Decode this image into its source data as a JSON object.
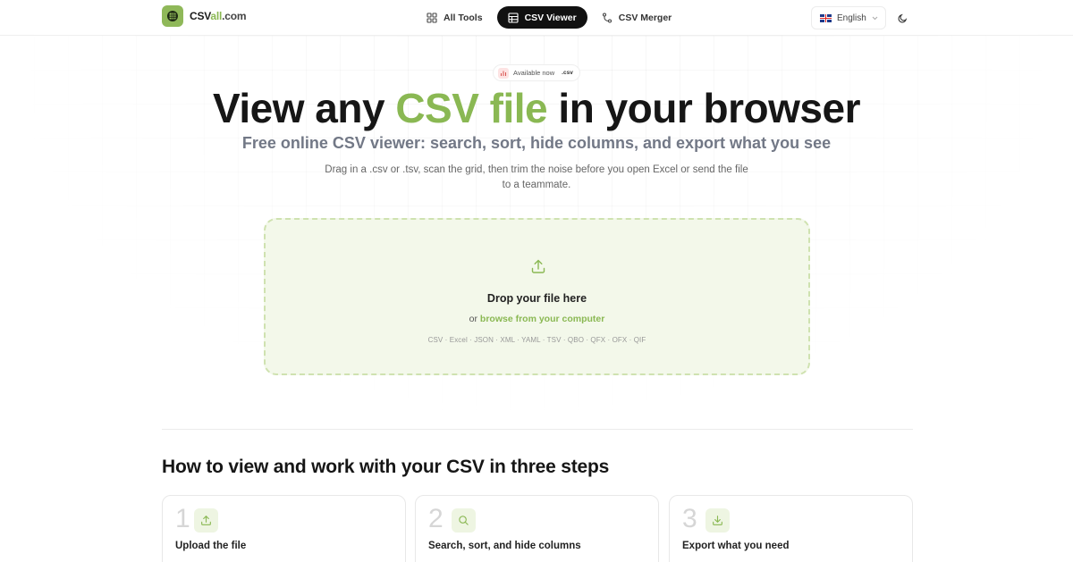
{
  "header": {
    "logo": {
      "prefix": "CSV",
      "accent": "all",
      "suffix": ".com"
    },
    "nav": [
      {
        "label": "All Tools",
        "icon": "grid-icon"
      },
      {
        "label": "CSV Viewer",
        "icon": "table-icon",
        "active": true
      },
      {
        "label": "CSV Merger",
        "icon": "merge-icon"
      }
    ],
    "language": {
      "label": "English",
      "flag": "uk-flag-icon"
    },
    "theme_toggle_icon": "moon-icon"
  },
  "hero": {
    "badge": {
      "text": "Available now",
      "ext": ".csv"
    },
    "title": {
      "part1": "View any ",
      "accent": "CSV file",
      "part2": " in your browser"
    },
    "subtitle": "Free online CSV viewer: search, sort, hide columns, and export what you see",
    "description": "Drag in a .csv or .tsv, scan the grid, then trim the noise before you open Excel or send the file to a teammate."
  },
  "dropzone": {
    "icon": "upload-icon",
    "title": "Drop your file here",
    "browse_prefix": "or ",
    "browse_link": "browse from your computer",
    "formats": "CSV · Excel · JSON · XML · YAML · TSV · QBO · QFX · OFX · QIF"
  },
  "steps_section": {
    "title": "How to view and work with your CSV in three steps",
    "steps": [
      {
        "number": "1",
        "icon": "upload-icon",
        "title": "Upload the file"
      },
      {
        "number": "2",
        "icon": "search-icon",
        "title": "Search, sort, and hide columns"
      },
      {
        "number": "3",
        "icon": "download-icon",
        "title": "Export what you need"
      }
    ]
  },
  "colors": {
    "accent": "#8ab853",
    "dropzone_bg": "#f3f8ea",
    "dropzone_border": "#cfe2b0",
    "active_nav_bg": "#111111"
  }
}
